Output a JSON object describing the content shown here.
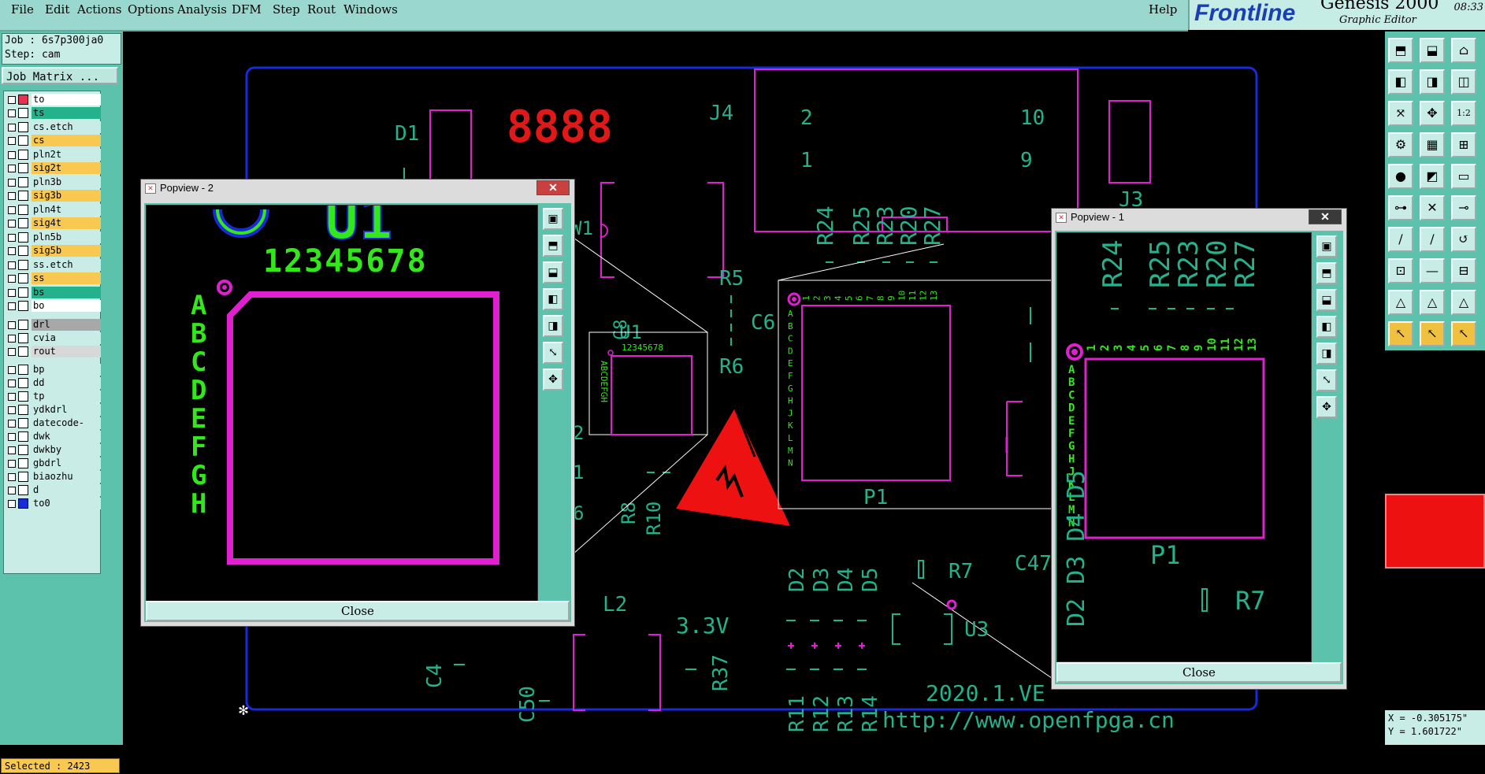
{
  "menubar": {
    "items": [
      "File",
      "Edit",
      "Actions",
      "Options",
      "Analysis",
      "DFM",
      "Step",
      "Rout",
      "Windows"
    ],
    "help": "Help"
  },
  "brand": {
    "logo": "Frontline",
    "product": "Genesis 2000",
    "subtitle": "Graphic Editor",
    "time": "08:33"
  },
  "job": {
    "job_label": "Job : 6s7p300ja0",
    "step_label": "Step: cam",
    "job_matrix_button": "Job Matrix ..."
  },
  "layers": [
    {
      "name": "to",
      "color": "#ffffff"
    },
    {
      "name": "ts",
      "color": "#23b28c"
    },
    {
      "name": "cs.etch",
      "color": "#c9ece6"
    },
    {
      "name": "cs",
      "color": "#f8c850"
    },
    {
      "name": "pln2t",
      "color": "#c9ece6"
    },
    {
      "name": "sig2t",
      "color": "#f8c850"
    },
    {
      "name": "pln3b",
      "color": "#c9ece6"
    },
    {
      "name": "sig3b",
      "color": "#f8c850"
    },
    {
      "name": "pln4t",
      "color": "#c9ece6"
    },
    {
      "name": "sig4t",
      "color": "#f8c850"
    },
    {
      "name": "pln5b",
      "color": "#c9ece6"
    },
    {
      "name": "sig5b",
      "color": "#f8c850"
    },
    {
      "name": "ss.etch",
      "color": "#c9ece6"
    },
    {
      "name": "ss",
      "color": "#f8c850"
    },
    {
      "name": "bs",
      "color": "#23b28c"
    },
    {
      "name": "bo",
      "color": "#ffffff"
    },
    {
      "name": "drl",
      "color": "#a8a8a8"
    },
    {
      "name": "cvia",
      "color": "#c9ece6"
    },
    {
      "name": "rout",
      "color": "#d8d8d8"
    },
    {
      "name": "bp",
      "color": "#c9ece6"
    },
    {
      "name": "dd",
      "color": "#c9ece6"
    },
    {
      "name": "tp",
      "color": "#c9ece6"
    },
    {
      "name": "ydkdrl",
      "color": "#c9ece6"
    },
    {
      "name": "datecode-ptc",
      "color": "#c9ece6"
    },
    {
      "name": "dwk",
      "color": "#c9ece6"
    },
    {
      "name": "dwkby",
      "color": "#c9ece6"
    },
    {
      "name": "gbdrl",
      "color": "#c9ece6"
    },
    {
      "name": "biaozhu",
      "color": "#c9ece6"
    },
    {
      "name": "d",
      "color": "#c9ece6"
    },
    {
      "name": "to0",
      "color": "#c9ece6"
    }
  ],
  "status": {
    "selected": "Selected : 2423",
    "x_coord": "X = -0.305175\"",
    "y_coord": "Y = 1.601722\""
  },
  "pcb": {
    "refs": {
      "d1": "D1",
      "j4": "J4",
      "j3": "J3",
      "r5": "R5",
      "r6": "R6",
      "c6": "C6",
      "u1": "U1",
      "c8": "C8",
      "p1": "P1",
      "r7": "R7",
      "u3": "U3",
      "l2": "L2",
      "c50": "C50",
      "c4": "C4",
      "c47": "C47",
      "r37": "R37",
      "r8": "R8",
      "r10": "R10",
      "voltage": "3.3V",
      "version": "2020.1.VE",
      "url": "http://www.openfpga.cn",
      "seg": "8888",
      "j4_pins": [
        "2",
        "10",
        "1",
        "9"
      ],
      "r_top": [
        "R24",
        "R25",
        "R23",
        "R20",
        "R27"
      ],
      "d_row": [
        "D2",
        "D3",
        "D4",
        "D5"
      ],
      "r_row": [
        "R11",
        "R12",
        "R13",
        "R14"
      ],
      "u1_cols": "12345678",
      "u1_rows": "ABCDEFGH",
      "p1_cols": [
        "1",
        "2",
        "3",
        "4",
        "5",
        "6",
        "7",
        "8",
        "9",
        "10",
        "11",
        "12",
        "13"
      ],
      "p1_rows": [
        "A",
        "B",
        "C",
        "D",
        "E",
        "F",
        "G",
        "H",
        "J",
        "K",
        "L",
        "M",
        "N"
      ],
      "frag_w1": "W1",
      "frag_2": "2",
      "frag_1": "1",
      "frag_6": "6"
    }
  },
  "popview2": {
    "title": "Popview - 2",
    "close_label": "Close",
    "u1_label": "U1",
    "cols": "12345678",
    "rows": [
      "A",
      "B",
      "C",
      "D",
      "E",
      "F",
      "G",
      "H"
    ]
  },
  "popview1": {
    "title": "Popview - 1",
    "close_label": "Close",
    "r_labels": [
      "R24",
      "R25",
      "R23",
      "R20",
      "R27"
    ],
    "cols": [
      "1",
      "2",
      "3",
      "4",
      "5",
      "6",
      "7",
      "8",
      "9",
      "10",
      "11",
      "12",
      "13"
    ],
    "rows": [
      "A",
      "B",
      "C",
      "D",
      "E",
      "F",
      "G",
      "H",
      "J",
      "K",
      "L",
      "M",
      "N"
    ],
    "p1_label": "P1",
    "r7_label": "R7",
    "bottom_frag": "D2 D3 D4 D5"
  },
  "colors": {
    "silk": "#23b28c",
    "pad": "#e020d0",
    "outline": "#1a2ad8",
    "highlight": "#33e81a",
    "seg": "#e01818",
    "esd": "#ee1111"
  }
}
